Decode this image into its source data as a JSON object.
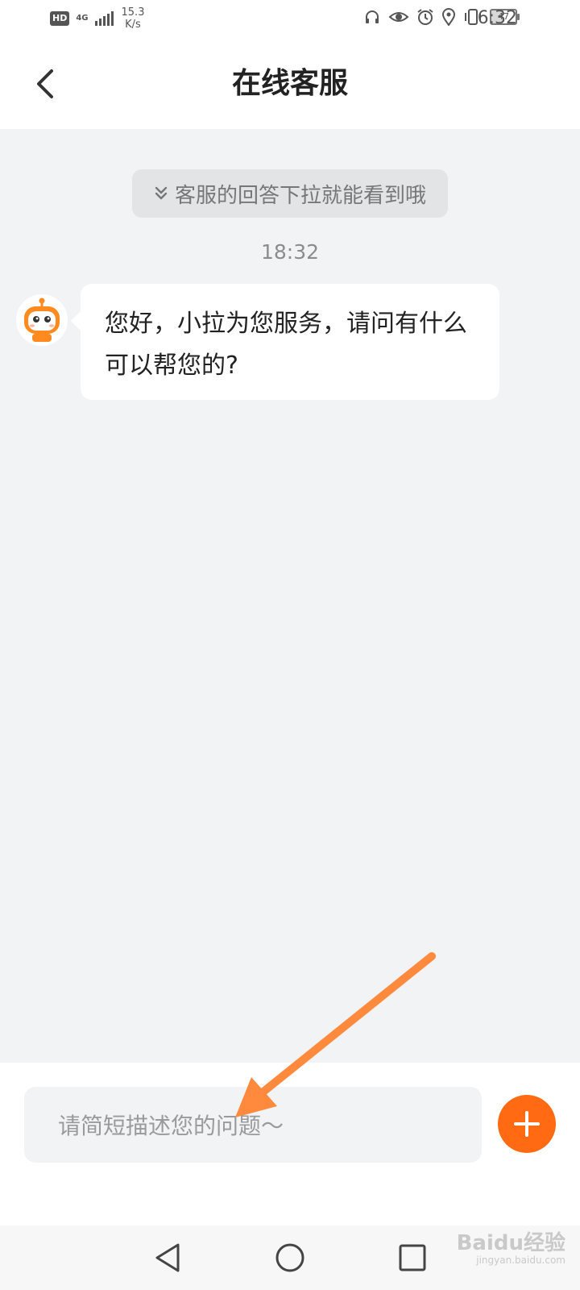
{
  "status_bar": {
    "hd_badge": "HD",
    "network": "4G",
    "speed_value": "15.3",
    "speed_unit": "K/s",
    "battery": "47",
    "time": "6:32",
    "icons": [
      "headset-icon",
      "eye-icon",
      "alarm-icon",
      "location-icon",
      "vibrate-icon",
      "battery-icon"
    ]
  },
  "header": {
    "title": "在线客服"
  },
  "chat": {
    "hint": "客服的回答下拉就能看到哦",
    "timestamp": "18:32",
    "messages": [
      {
        "sender": "bot",
        "text": "您好，小拉为您服务，请问有什么可以帮您的?"
      }
    ]
  },
  "input": {
    "placeholder": "请简短描述您的问题～"
  },
  "watermark": {
    "brand": "Baidu经验",
    "url": "jingyan.baidu.com"
  },
  "colors": {
    "accent": "#ff6a13",
    "annotation_arrow": "#ff8a3d",
    "chat_bg": "#f2f3f5"
  }
}
